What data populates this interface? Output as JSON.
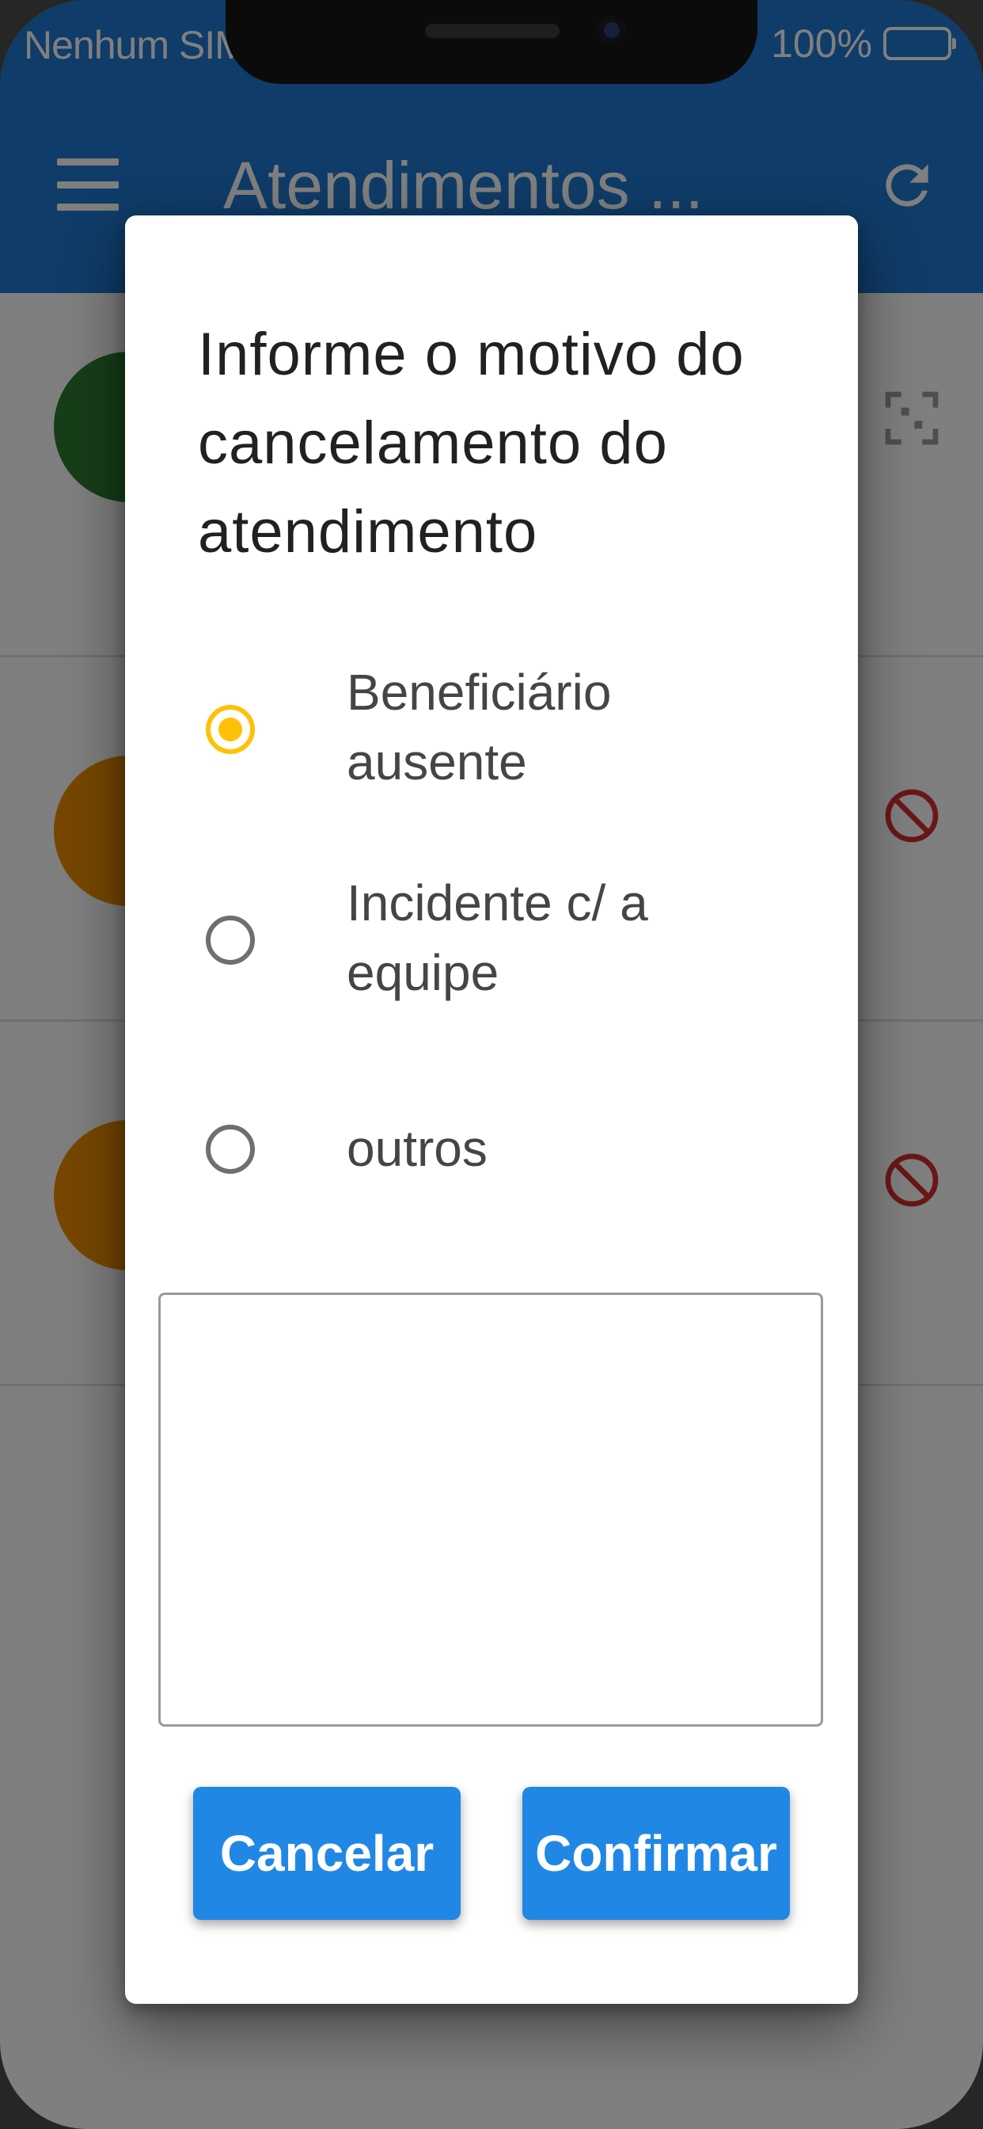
{
  "status_bar": {
    "carrier": "Nenhum SIM",
    "battery": "100%"
  },
  "app_bar": {
    "title": "Atendimentos ..."
  },
  "list_items": [
    {
      "avatar_color": "#2e7d32",
      "action_icon": "qr-scan-icon"
    },
    {
      "avatar_color": "#ef8f00",
      "action_icon": "block-icon"
    },
    {
      "avatar_color": "#ef8f00",
      "action_icon": "block-icon"
    }
  ],
  "dialog": {
    "title": "Informe o motivo do cancelamento do atendimento",
    "options": [
      {
        "label": "Beneficiário ausente",
        "checked": true
      },
      {
        "label": "Incidente c/ a equipe",
        "checked": false
      },
      {
        "label": "outros",
        "checked": false
      }
    ],
    "textarea_value": "",
    "cancel_label": "Cancelar",
    "confirm_label": "Confirmar"
  },
  "colors": {
    "primary": "#1f78d1",
    "button": "#2187e5",
    "radio_checked": "#ffc107",
    "block_icon": "#d32f2f"
  }
}
